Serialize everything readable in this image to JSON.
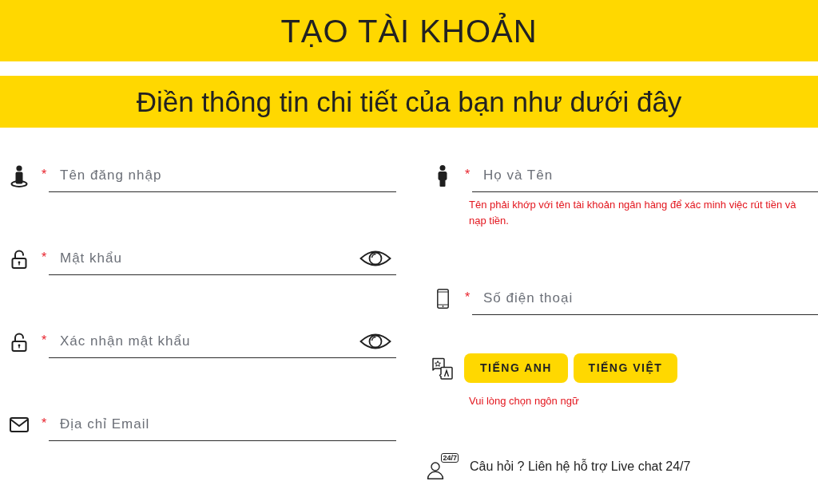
{
  "header": {
    "title": "TẠO TÀI KHOẢN"
  },
  "subheader": {
    "text": "Điền thông tin chi tiết của bạn như dưới đây"
  },
  "form": {
    "left_column": [
      {
        "kind": "username",
        "mark": "*",
        "placeholder": "Tên đăng nhập"
      },
      {
        "kind": "password",
        "mark": "*",
        "placeholder": "Mật khẩu"
      },
      {
        "kind": "password",
        "mark": "*",
        "placeholder": "Xác nhận mật khẩu"
      },
      {
        "kind": "email",
        "mark": "*",
        "placeholder": "Địa chỉ Email"
      }
    ],
    "right_column": [
      {
        "kind": "full_name",
        "mark": "*",
        "placeholder": "Họ và Tên",
        "hint": "Tên phải khớp với tên tài khoản ngân hàng để xác minh việc rút tiền và nạp tiền."
      },
      {
        "kind": "phone",
        "mark": "*",
        "placeholder": "Số điện thoại"
      },
      {
        "kind": "language",
        "options": [
          {
            "label": "TIẾNG ANH",
            "selected": false
          },
          {
            "label": "TIẾNG VIỆT",
            "selected": false
          }
        ],
        "error": "Vui lòng chọn ngôn ngữ"
      },
      {
        "kind": "support",
        "badge": "24/7",
        "text": "Câu hỏi ? Liên hệ hỗ trợ Live chat 24/7"
      }
    ]
  }
}
